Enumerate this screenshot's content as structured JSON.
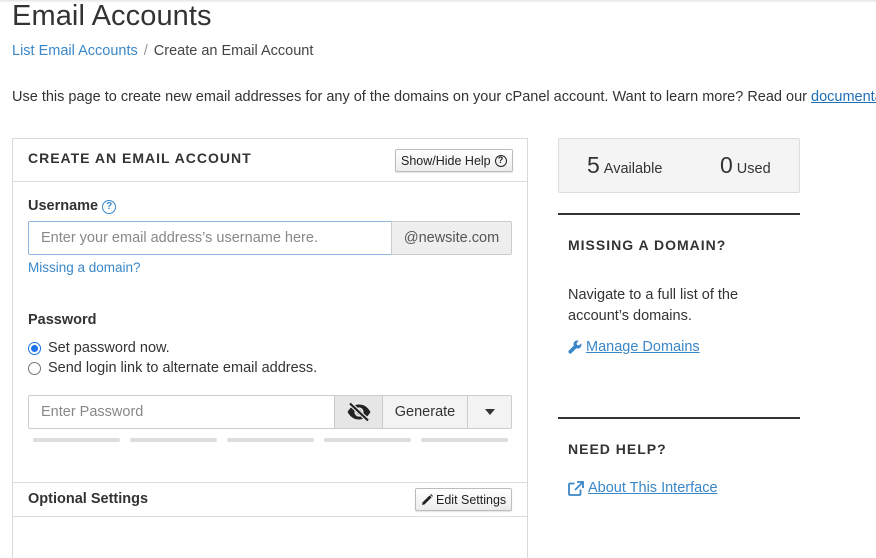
{
  "header": {
    "title": "Email Accounts",
    "breadcrumb": {
      "parent": "List Email Accounts",
      "separator": "/",
      "current": "Create an Email Account"
    },
    "intro_text": "Use this page to create new email addresses for any of the domains on your cPanel account. Want to learn more? Read our",
    "intro_link": "documentation"
  },
  "form": {
    "title": "CREATE AN EMAIL ACCOUNT",
    "help_button": "Show/Hide Help",
    "username": {
      "label": "Username",
      "value": "",
      "placeholder": "Enter your email address’s username here.",
      "domain": "@newsite.com",
      "missing_domain_link": "Missing a domain?"
    },
    "password": {
      "label": "Password",
      "options": [
        {
          "label": "Set password now.",
          "selected": true
        },
        {
          "label": "Send login link to alternate email address.",
          "selected": false
        }
      ],
      "value": "",
      "placeholder": "Enter Password",
      "visibility_icon": "eye-slash-icon",
      "generate_label": "Generate",
      "strength_level": 0
    },
    "optional_settings": {
      "title": "Optional Settings",
      "edit_button": "Edit Settings"
    }
  },
  "stats": {
    "available": {
      "count": "5",
      "label": "Available"
    },
    "used": {
      "count": "0",
      "label": "Used"
    }
  },
  "sidebar": {
    "missing_domain": {
      "title": "MISSING A DOMAIN?",
      "text": "Navigate to a full list of the account’s domains.",
      "link": "Manage Domains",
      "icon": "wrench-icon"
    },
    "need_help": {
      "title": "NEED HELP?",
      "link": "About This Interface",
      "icon": "external-link-icon"
    }
  },
  "colors": {
    "link": "#3a87c8",
    "radio_selected": "#1a73e8",
    "input_focus_border": "#8fb8de"
  }
}
